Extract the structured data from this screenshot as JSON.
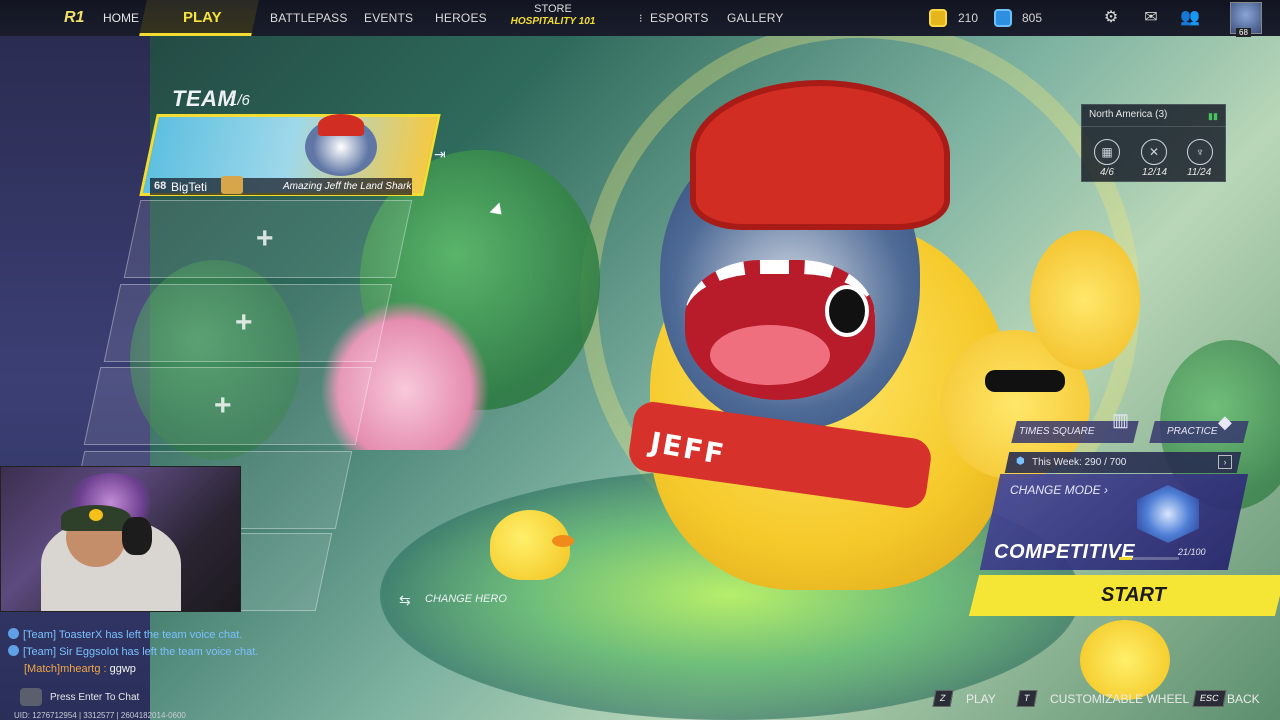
{
  "nav": {
    "logo": "R1",
    "home": "HOME",
    "play": "PLAY",
    "battlepass": "BATTLEPASS",
    "events": "EVENTS",
    "heroes": "HEROES",
    "store": "STORE",
    "store_promo": "HOSPITALITY 101",
    "esports": "ESPORTS",
    "gallery": "GALLERY",
    "gold_currency": "210",
    "blue_currency": "805",
    "avatar_level": "68"
  },
  "team": {
    "title": "TEAM",
    "count": "1/6",
    "member": {
      "level": "68",
      "name": "BigTeti",
      "hero": "Amazing Jeff the Land Shark"
    },
    "empty_slot_icon": "+"
  },
  "region": {
    "name": "North America (3)",
    "stats": [
      {
        "icon": "trophy-icon",
        "value": "4/6"
      },
      {
        "icon": "crossed-swords-icon",
        "value": "12/14"
      },
      {
        "icon": "cup-icon",
        "value": "11/24"
      }
    ]
  },
  "mascot": {
    "scarf_text": "JEFF"
  },
  "mode": {
    "map_label": "TIMES SQUARE",
    "practice_label": "PRACTICE",
    "week_label": "This Week:",
    "week_value": "290 / 700",
    "change_mode": "CHANGE MODE",
    "name": "COMPETITIVE",
    "rank_progress": "21/100",
    "rank_fraction": 0.21,
    "start": "START"
  },
  "change_hero": "CHANGE HERO",
  "chat": {
    "lines": [
      {
        "prefix": "[Team]",
        "text": "ToasterX has left the team voice chat."
      },
      {
        "prefix": "[Team]",
        "text": "Sir Eggsolot has left the team voice chat."
      },
      {
        "prefix": "[Match]",
        "name": "mheartg",
        "text": "ggwp"
      }
    ],
    "press_enter": "Press Enter To Chat",
    "uid": "UID: 1276712954 | 3312577 | 2604182014-0600"
  },
  "hints": [
    {
      "key": "Z",
      "label": "PLAY"
    },
    {
      "key": "T",
      "label": "CUSTOMIZABLE WHEEL"
    },
    {
      "key": "ESC",
      "label": "BACK"
    }
  ],
  "colors": {
    "accent_yellow": "#f3dd32",
    "team_chat_blue": "#7cc0ff",
    "match_chat_orange": "#f2a64a",
    "start_button": "#f5e534"
  }
}
